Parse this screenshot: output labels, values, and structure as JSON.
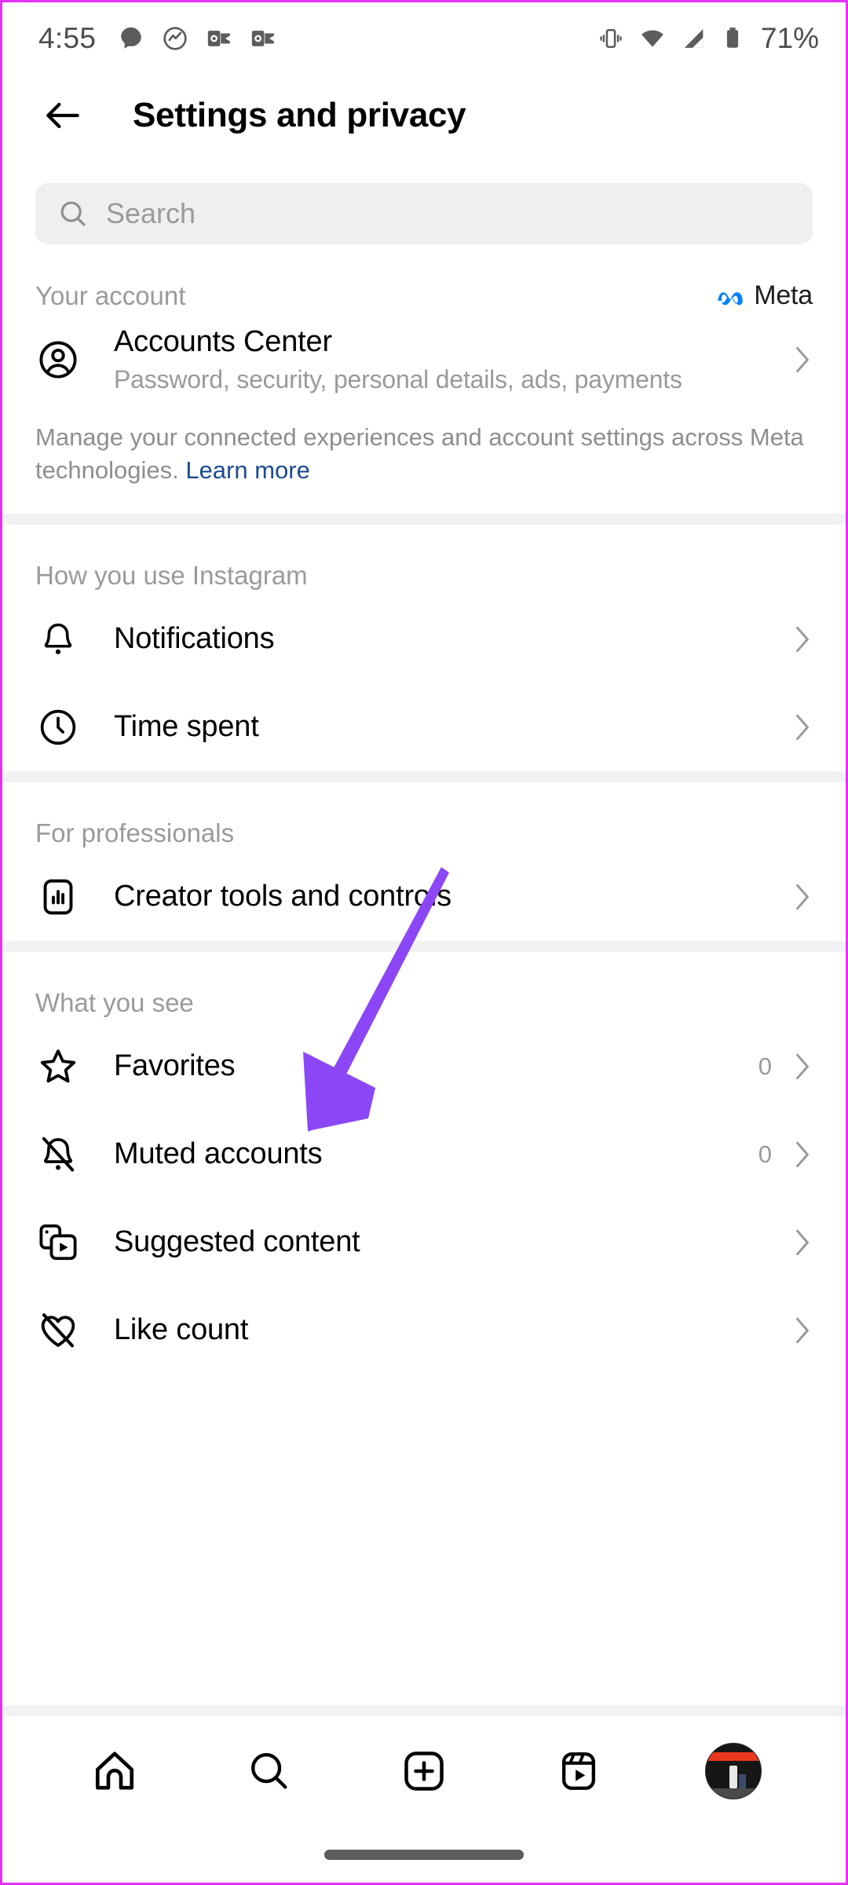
{
  "status_bar": {
    "time": "4:55",
    "battery_percent": "71%",
    "left_icons": [
      "chat-bubble-icon",
      "snapchat-icon",
      "outlook-icon",
      "outlook-icon"
    ],
    "right_icons": [
      "vibrate-icon",
      "wifi-icon",
      "cellular-signal-icon",
      "battery-icon"
    ]
  },
  "header": {
    "back_icon": "back-arrow-icon",
    "title": "Settings and privacy"
  },
  "search": {
    "placeholder": "Search",
    "icon": "search-icon"
  },
  "sections": [
    {
      "title": "Your account",
      "badge": {
        "icon": "meta-infinity-logo",
        "label": "Meta",
        "color": "#0082fb"
      },
      "rows": [
        {
          "icon": "account-circle-icon",
          "label": "Accounts Center",
          "subtitle": "Password, security, personal details, ads, payments",
          "value": "",
          "chevron": "chevron-right-icon"
        }
      ],
      "note": {
        "text": "Manage your connected experiences and account settings across Meta technologies.",
        "link": "Learn more"
      }
    },
    {
      "title": "How you use Instagram",
      "rows": [
        {
          "icon": "bell-icon",
          "label": "Notifications",
          "value": "",
          "chevron": "chevron-right-icon"
        },
        {
          "icon": "clock-icon",
          "label": "Time spent",
          "value": "",
          "chevron": "chevron-right-icon"
        }
      ]
    },
    {
      "title": "For professionals",
      "rows": [
        {
          "icon": "bar-chart-icon",
          "label": "Creator tools and controls",
          "value": "",
          "chevron": "chevron-right-icon"
        }
      ]
    },
    {
      "title": "What you see",
      "rows": [
        {
          "icon": "star-icon",
          "label": "Favorites",
          "value": "0",
          "chevron": "chevron-right-icon"
        },
        {
          "icon": "bell-slash-icon",
          "label": "Muted accounts",
          "value": "0",
          "chevron": "chevron-right-icon"
        },
        {
          "icon": "suggested-content-icon",
          "label": "Suggested content",
          "value": "",
          "chevron": "chevron-right-icon"
        },
        {
          "icon": "heart-slash-icon",
          "label": "Like count",
          "value": "",
          "chevron": "chevron-right-icon"
        }
      ]
    }
  ],
  "annotation": {
    "type": "arrow",
    "color": "#8b47f5",
    "points_to": "Creator tools and controls"
  },
  "bottom_nav": {
    "items": [
      {
        "icon": "home-icon",
        "name": "home"
      },
      {
        "icon": "search-icon",
        "name": "search"
      },
      {
        "icon": "create-plus-icon",
        "name": "create"
      },
      {
        "icon": "reels-icon",
        "name": "reels"
      },
      {
        "icon": "profile-avatar",
        "name": "profile"
      }
    ]
  }
}
